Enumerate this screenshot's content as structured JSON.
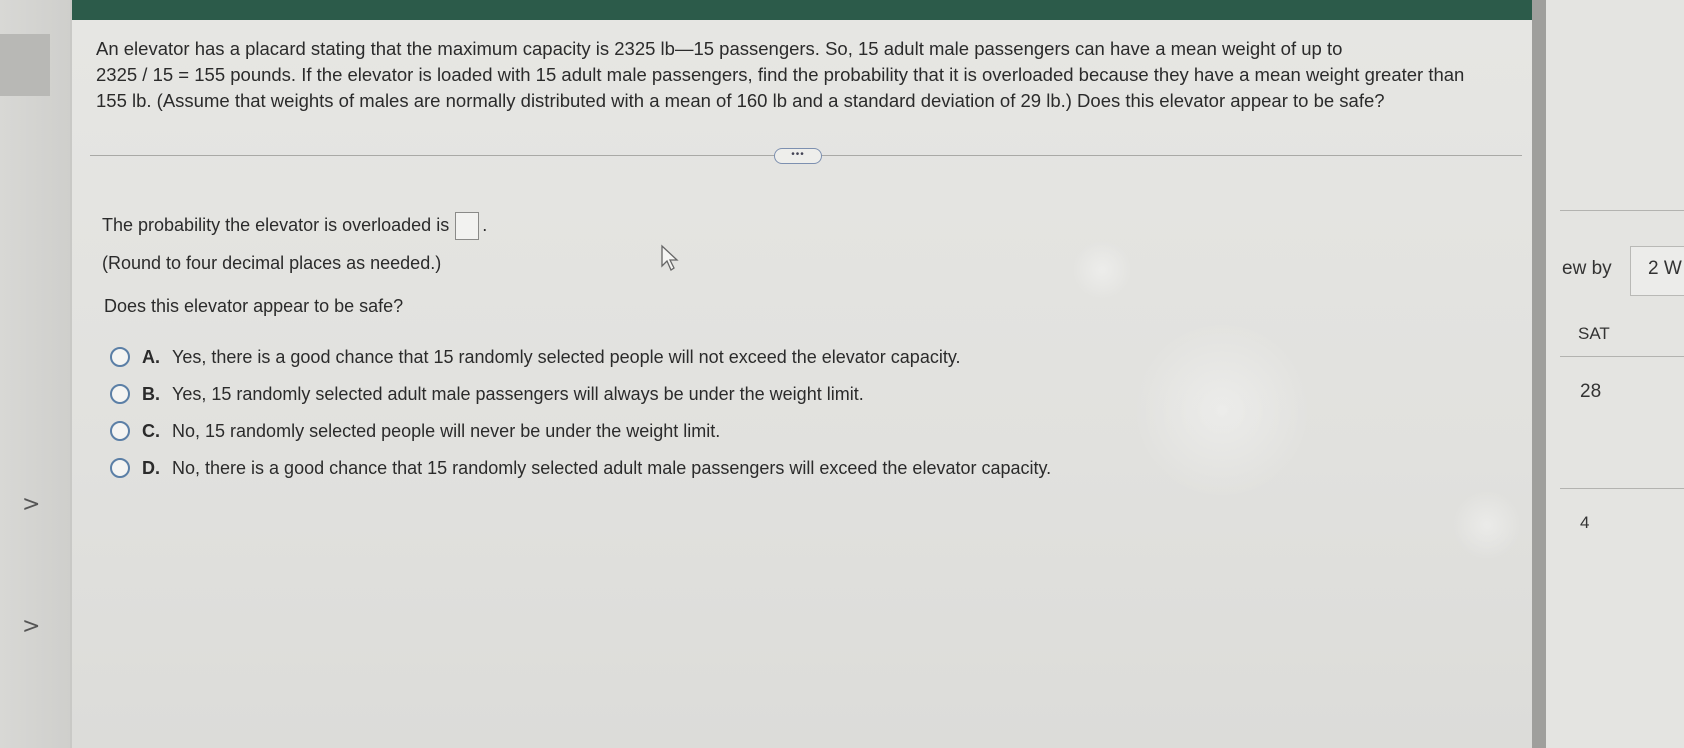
{
  "question": {
    "line1": "An elevator has a placard stating that the maximum capacity is 2325 lb—15 passengers. So, 15 adult male passengers can have a mean weight of up to",
    "line2": "2325 / 15 = 155 pounds. If the elevator is loaded with 15 adult male passengers, find the probability that it is overloaded because they have a mean weight greater than",
    "line3": "155 lb. (Assume that weights of males are normally distributed with a mean of 160 lb and a standard deviation of 29 lb.) Does this elevator appear to be safe?"
  },
  "more_button_label": "•••",
  "probability": {
    "prompt": "The probability the elevator is overloaded is",
    "value": "",
    "suffix": ".",
    "round_note": "(Round to four decimal places as needed.)"
  },
  "safety_question": "Does this elevator appear to be safe?",
  "options": [
    {
      "letter": "A.",
      "text": "Yes, there is a good chance that 15 randomly selected people will not exceed the elevator capacity."
    },
    {
      "letter": "B.",
      "text": "Yes, 15 randomly selected adult male passengers will always be under the weight limit."
    },
    {
      "letter": "C.",
      "text": "No, 15 randomly selected people will never be under the weight limit."
    },
    {
      "letter": "D.",
      "text": "No, there is a good chance that 15 randomly selected adult male passengers will exceed the elevator capacity."
    }
  ],
  "left_nav": {
    "chevron1": ">",
    "chevron2": ">"
  },
  "right_panel": {
    "label_ew_by": "ew by",
    "box_text": "2 W",
    "sat": "SAT",
    "num28": "28",
    "num4": "4"
  },
  "colors": {
    "header_green": "#2c5b4a",
    "radio_blue": "#5b7fa6"
  }
}
